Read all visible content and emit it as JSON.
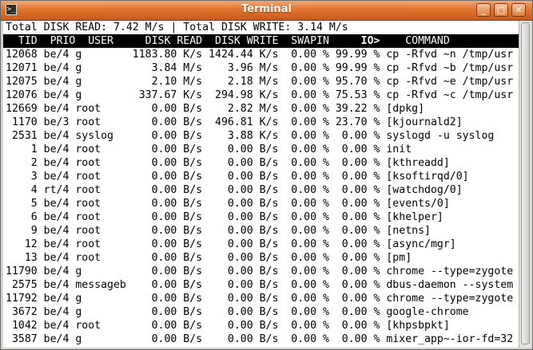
{
  "window": {
    "title": "Terminal"
  },
  "summary": {
    "line": "Total DISK READ: 7.42 M/s | Total DISK WRITE: 3.14 M/s"
  },
  "columns": {
    "line_pre": "  TID  PRIO  USER     DISK READ  DISK WRITE  SWAPIN     ",
    "io": "IO>",
    "line_post": "    COMMAND"
  },
  "rows": [
    "12068 be/4 g        1183.80 K/s 1424.44 K/s  0.00 % 99.99 % cp -Rfvd ~n /tmp/usr",
    "12071 be/4 g           3.84 M/s    3.96 M/s  0.00 % 99.99 % cp -Rfvd ~b /tmp/usr",
    "12075 be/4 g           2.10 M/s    2.18 M/s  0.00 % 95.70 % cp -Rfvd ~e /tmp/usr",
    "12076 be/4 g         337.67 K/s  294.98 K/s  0.00 % 75.53 % cp -Rfvd ~c /tmp/usr",
    "12669 be/4 root        0.00 B/s    2.82 M/s  0.00 % 39.22 % [dpkg]",
    " 1170 be/3 root        0.00 B/s  496.81 K/s  0.00 % 23.70 % [kjournald2]",
    " 2531 be/4 syslog      0.00 B/s    3.88 K/s  0.00 %  0.00 % syslogd -u syslog",
    "    1 be/4 root        0.00 B/s    0.00 B/s  0.00 %  0.00 % init",
    "    2 be/4 root        0.00 B/s    0.00 B/s  0.00 %  0.00 % [kthreadd]",
    "    3 be/4 root        0.00 B/s    0.00 B/s  0.00 %  0.00 % [ksoftirqd/0]",
    "    4 rt/4 root        0.00 B/s    0.00 B/s  0.00 %  0.00 % [watchdog/0]",
    "    5 be/4 root        0.00 B/s    0.00 B/s  0.00 %  0.00 % [events/0]",
    "    6 be/4 root        0.00 B/s    0.00 B/s  0.00 %  0.00 % [khelper]",
    "    9 be/4 root        0.00 B/s    0.00 B/s  0.00 %  0.00 % [netns]",
    "   12 be/4 root        0.00 B/s    0.00 B/s  0.00 %  0.00 % [async/mgr]",
    "   13 be/4 root        0.00 B/s    0.00 B/s  0.00 %  0.00 % [pm]",
    "11790 be/4 g           0.00 B/s    0.00 B/s  0.00 %  0.00 % chrome --type=zygote",
    " 2575 be/4 messageb    0.00 B/s    0.00 B/s  0.00 %  0.00 % dbus-daemon --system",
    "11792 be/4 g           0.00 B/s    0.00 B/s  0.00 %  0.00 % chrome --type=zygote",
    " 3672 be/4 g           0.00 B/s    0.00 B/s  0.00 %  0.00 % google-chrome",
    " 1042 be/4 root        0.00 B/s    0.00 B/s  0.00 %  0.00 % [khpsbpkt]",
    " 3587 be/4 g           0.00 B/s    0.00 B/s  0.00 %  0.00 % mixer_app~-ior-fd=32"
  ],
  "colors": {
    "titlebar": "#e0752d",
    "header_bg": "#000000",
    "header_fg": "#ffffff",
    "terminal_bg": "#ffffff"
  }
}
